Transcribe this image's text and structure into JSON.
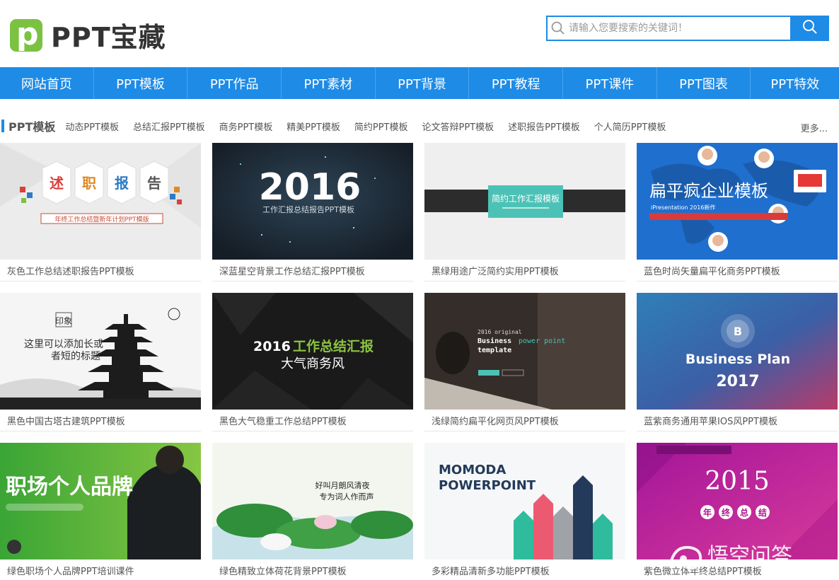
{
  "header": {
    "logo_letter": "p",
    "logo_text": "PPT宝藏",
    "search_placeholder": "请输入您要搜索的关键词！",
    "accent": "#1e8be6",
    "logo_green": "#7cc242"
  },
  "nav": {
    "items": [
      "网站首页",
      "PPT模板",
      "PPT作品",
      "PPT素材",
      "PPT背景",
      "PPT教程",
      "PPT课件",
      "PPT图表",
      "PPT特效"
    ]
  },
  "subbar": {
    "title": "PPT模板",
    "links": [
      "动态PPT模板",
      "总结汇报PPT模板",
      "商务PPT模板",
      "精美PPT模板",
      "简约PPT模板",
      "论文答辩PPT模板",
      "述职报告PPT模板",
      "个人简历PPT模板"
    ],
    "more": "更多..."
  },
  "cards": [
    {
      "caption": "灰色工作总结述职报告PPT模板",
      "thumb": {
        "t1": "述",
        "t2": "职",
        "t3": "报",
        "t4": "告",
        "sub": "年终工作总结暨新年计划PPT模版"
      }
    },
    {
      "caption": "深蓝星空背景工作总结汇报PPT模板",
      "thumb": {
        "big": "2016",
        "sub": "工作汇报总结报告PPT模板"
      }
    },
    {
      "caption": "黑绿用途广泛简约实用PPT模板",
      "thumb": {
        "title": "简约工作汇报模板"
      }
    },
    {
      "caption": "蓝色时尚矢量扁平化商务PPT模板",
      "thumb": {
        "title": "扁平疯企业模板",
        "sub": "iPresentation 2016新作"
      }
    },
    {
      "caption": "黑色中国古塔古建筑PPT模板",
      "thumb": {
        "seal": "印象",
        "line1": "这里可以添加长或",
        "line2": "者短的标题"
      }
    },
    {
      "caption": "黑色大气稳重工作总结PPT模板",
      "thumb": {
        "year": "2016",
        "hl": "工作总结汇报",
        "sub": "大气商务风"
      }
    },
    {
      "caption": "浅绿简约扁平化网页风PPT模板",
      "thumb": {
        "l1": "2016 original",
        "l2a": "Business",
        "l2b": "power point",
        "l3": "template"
      }
    },
    {
      "caption": "蓝紫商务通用苹果IOS风PPT模板",
      "thumb": {
        "badge": "B",
        "t1": "Business Plan",
        "t2": "2017"
      }
    },
    {
      "caption": "绿色职场个人品牌PPT培训课件",
      "thumb": {
        "title": "职场个人品牌"
      }
    },
    {
      "caption": "绿色精致立体荷花背景PPT模板",
      "thumb": {
        "l1": "好叫月朗风清夜",
        "l2": "专为词人作而声"
      }
    },
    {
      "caption": "多彩精品清新多功能PPT模板",
      "thumb": {
        "t1": "MOMODA",
        "t2": "POWERPOINT"
      }
    },
    {
      "caption": "紫色微立体年终总结PPT模板",
      "thumb": {
        "year": "2015",
        "c1": "年",
        "c2": "终",
        "c3": "总",
        "c4": "结"
      }
    }
  ],
  "watermark": {
    "text": "悟空问答"
  }
}
